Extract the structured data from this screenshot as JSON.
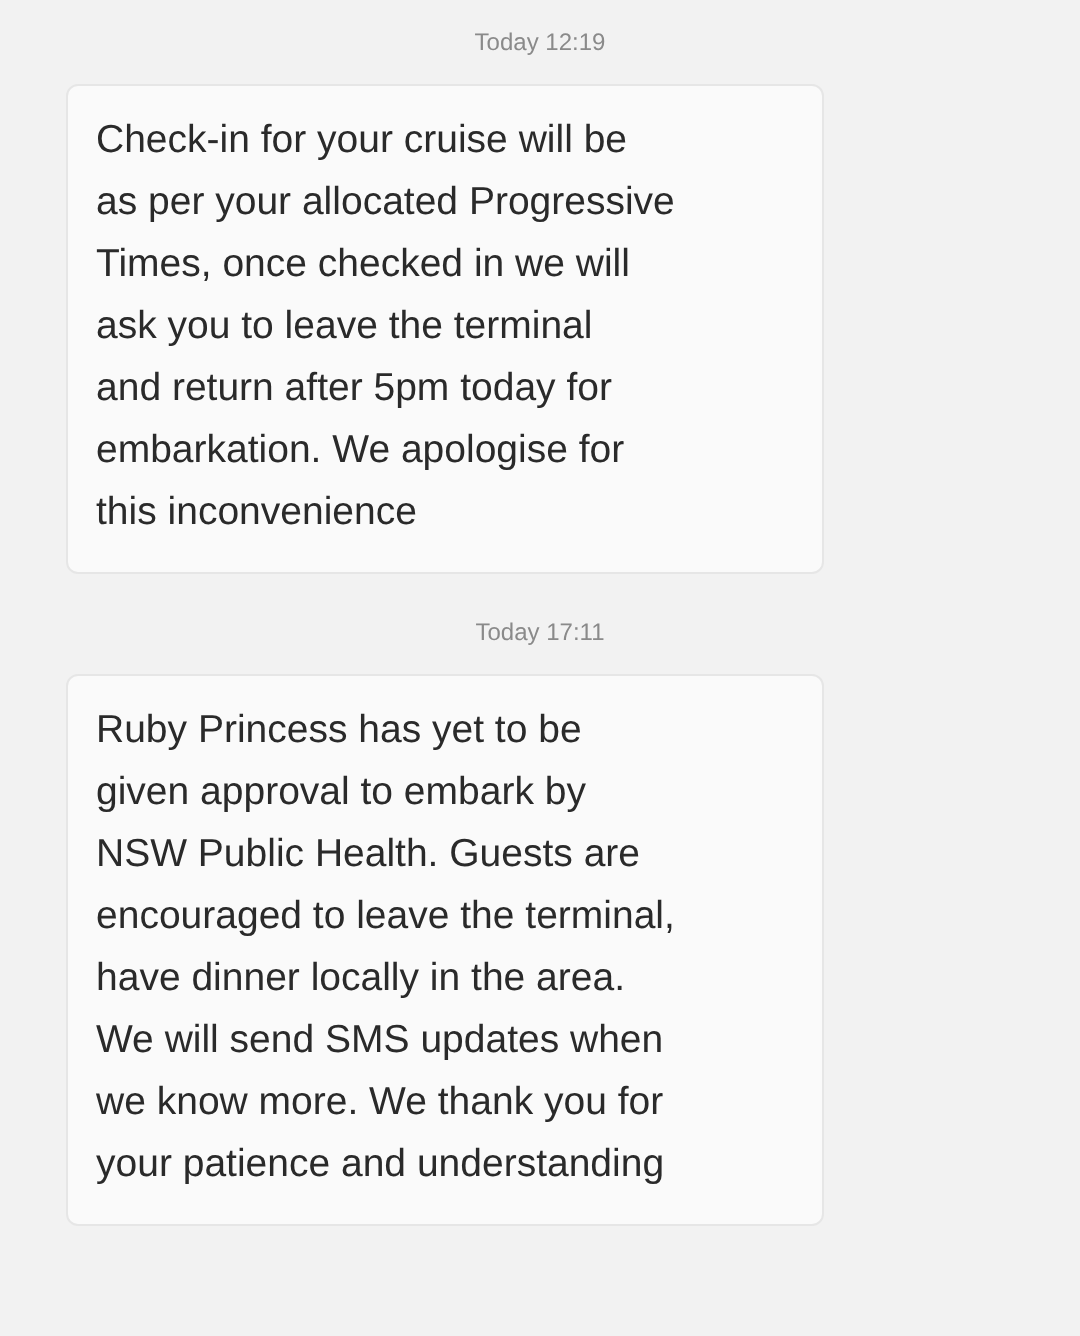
{
  "messages": [
    {
      "timestamp": "Today 12:19",
      "text": "Check-in for your cruise will be\nas per your allocated Progressive\nTimes, once checked in we will\nask you to leave the terminal\nand return after 5pm today for\nembarkation. We apologise for\nthis inconvenience"
    },
    {
      "timestamp": "Today 17:11",
      "text": "Ruby Princess has yet to be\ngiven approval to embark by\nNSW Public Health. Guests are\nencouraged to leave the terminal,\nhave dinner locally in the area.\nWe will send SMS updates when\nwe know more. We thank you for\nyour patience and understanding"
    }
  ]
}
